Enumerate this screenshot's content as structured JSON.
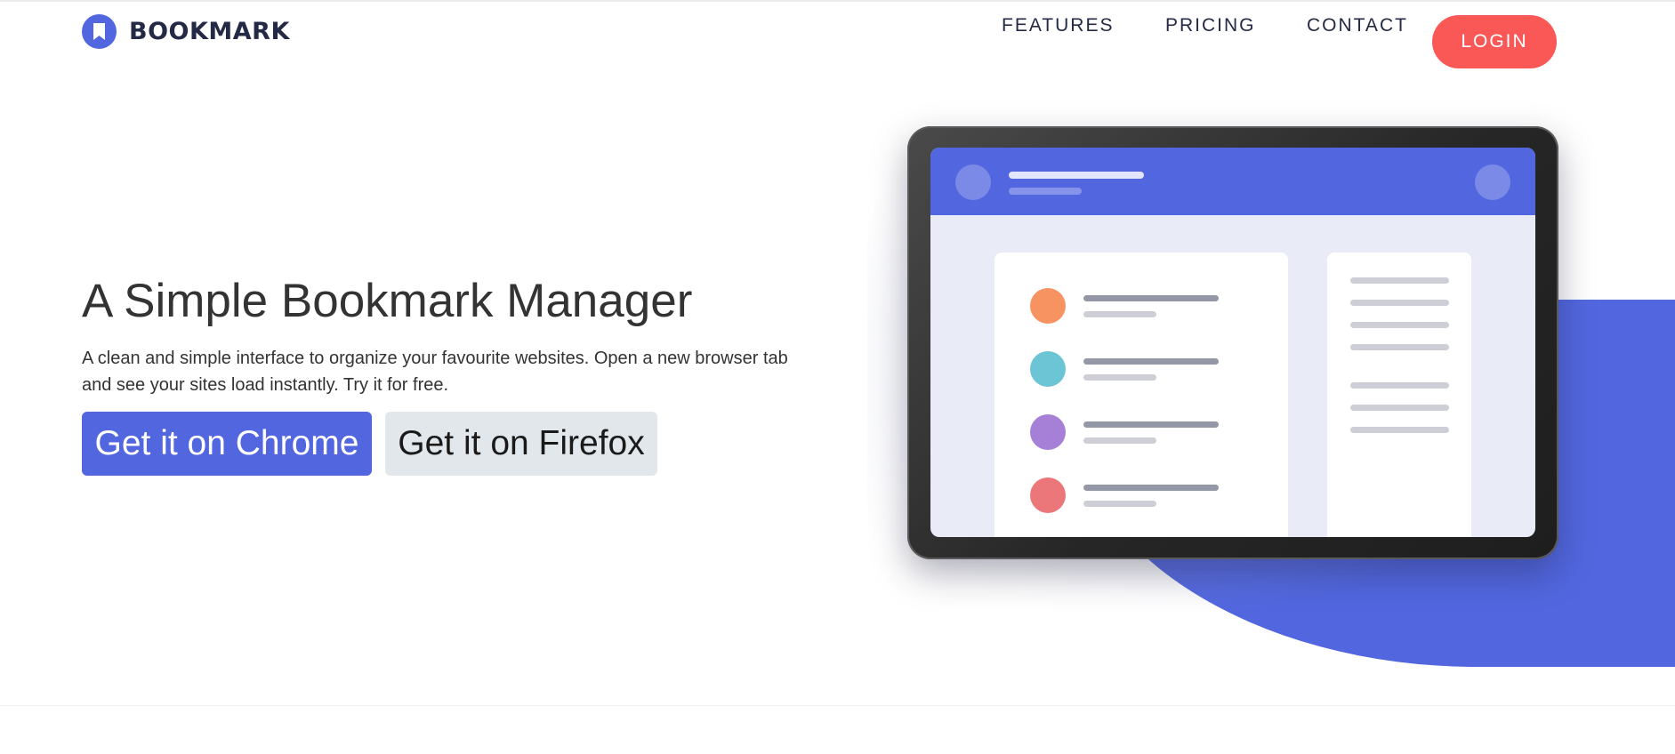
{
  "brand": {
    "name": "BOOKMARK",
    "icon": "bookmark-icon",
    "color": "#5267df"
  },
  "nav": {
    "features": "FEATURES",
    "pricing": "PRICING",
    "contact": "CONTACT",
    "login": "LOGIN"
  },
  "hero": {
    "title": "A Simple Bookmark Manager",
    "description": "A clean and simple interface to organize your favourite websites. Open a new browser tab and see your sites load instantly. Try it for free.",
    "chrome_button": "Get it on Chrome",
    "firefox_button": "Get it on Firefox"
  },
  "colors": {
    "primary": "#5267df",
    "accent_red": "#fa5757",
    "dot_orange": "#f79361",
    "dot_cyan": "#6cc5d5",
    "dot_purple": "#a67fd6",
    "dot_red": "#ec777b"
  }
}
